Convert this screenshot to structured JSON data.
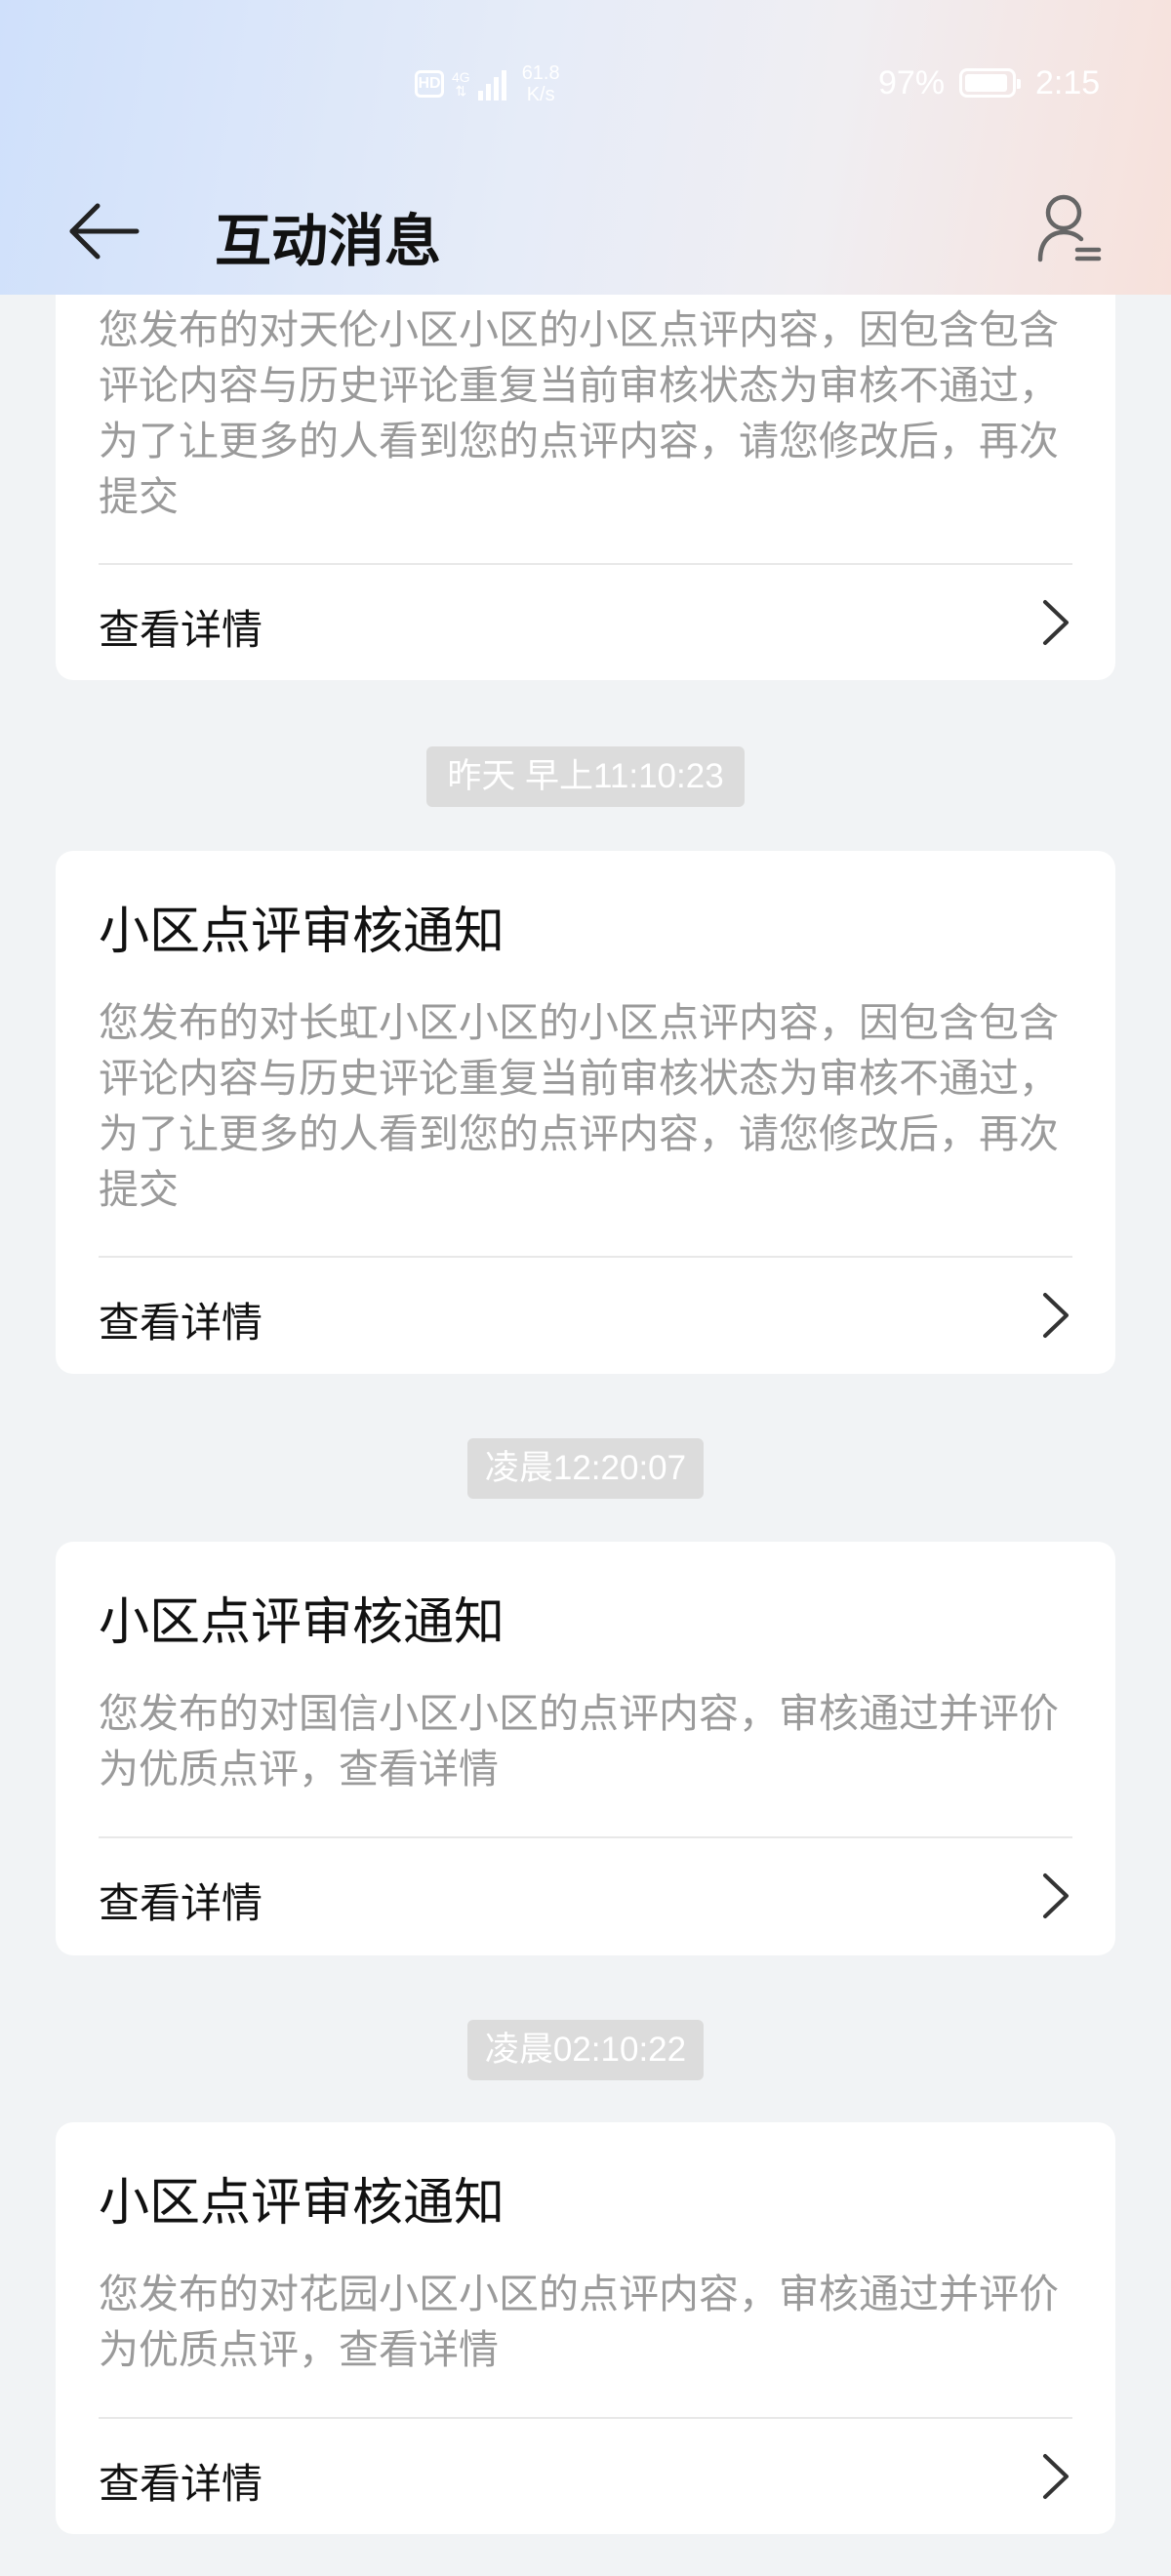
{
  "status_bar": {
    "hd_label": "HD",
    "network_type": "4G",
    "speed_value": "61.8",
    "speed_unit": "K/s",
    "battery_percent": "97%",
    "time": "2:15"
  },
  "header": {
    "back_icon": "arrow-left-icon",
    "title": "互动消息",
    "profile_icon": "user-list-icon"
  },
  "messages": [
    {
      "title": "",
      "body": "您发布的对天伦小区小区的小区点评内容，因包含包含评论内容与历史评论重复当前审核状态为审核不通过，为了让更多的人看到您的点评内容，请您修改后，再次提交",
      "link": "查看详情"
    },
    {
      "timestamp": "昨天 早上11:10:23",
      "title": "小区点评审核通知",
      "body": "您发布的对长虹小区小区的小区点评内容，因包含包含评论内容与历史评论重复当前审核状态为审核不通过，为了让更多的人看到您的点评内容，请您修改后，再次提交",
      "link": "查看详情"
    },
    {
      "timestamp": "凌晨12:20:07",
      "title": "小区点评审核通知",
      "body": "您发布的对国信小区小区的点评内容，审核通过并评价为优质点评，查看详情",
      "link": "查看详情"
    },
    {
      "timestamp": "凌晨02:10:22",
      "title": "小区点评审核通知",
      "body": "您发布的对花园小区小区的点评内容，审核通过并评价为优质点评，查看详情",
      "link": "查看详情"
    }
  ],
  "colors": {
    "card_bg": "#ffffff",
    "page_bg": "#f1f3f5",
    "title_text": "#111111",
    "body_text": "#9a9a9a",
    "timestamp_bg": "#dcdcdc"
  }
}
